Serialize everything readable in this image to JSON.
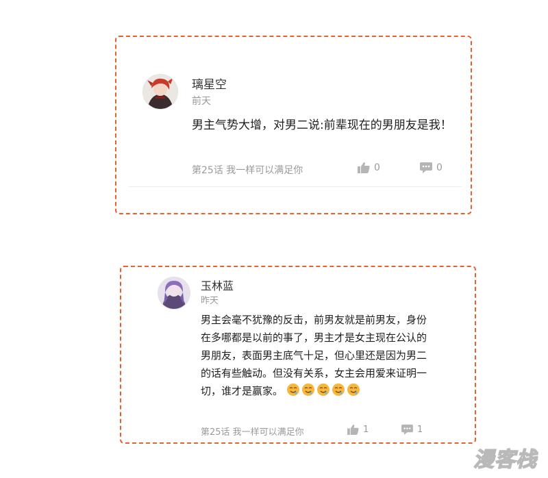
{
  "comments": [
    {
      "username": "璃星空",
      "time": "前天",
      "text": "男主气势大增，对男二说:前辈现在的男朋友是我！",
      "chapter": "第25话 我一样可以满足你",
      "likes": "0",
      "replies": "0"
    },
    {
      "username": "玉林蓝",
      "time": "昨天",
      "text": "男主会毫不犹豫的反击，前男友就是前男友，身份在多哪都是以前的事了，男主才是女主现在公认的男朋友，表面男主底气十足，但心里还是因为男二的话有些触动。但没有关系，女主会用爱来证明一切，谁才是赢家。",
      "chapter": "第25话 我一样可以满足你",
      "likes": "1",
      "replies": "1"
    }
  ],
  "icons": {
    "like": "thumbs-up-icon",
    "comment": "comment-bubble-icon",
    "emoji": "drooling-face-emoji"
  },
  "colors": {
    "dashed_border": "#e8612c",
    "meta_text": "#9a9a9a",
    "emoji": "#f6b73c"
  },
  "watermark": "漫客栈"
}
